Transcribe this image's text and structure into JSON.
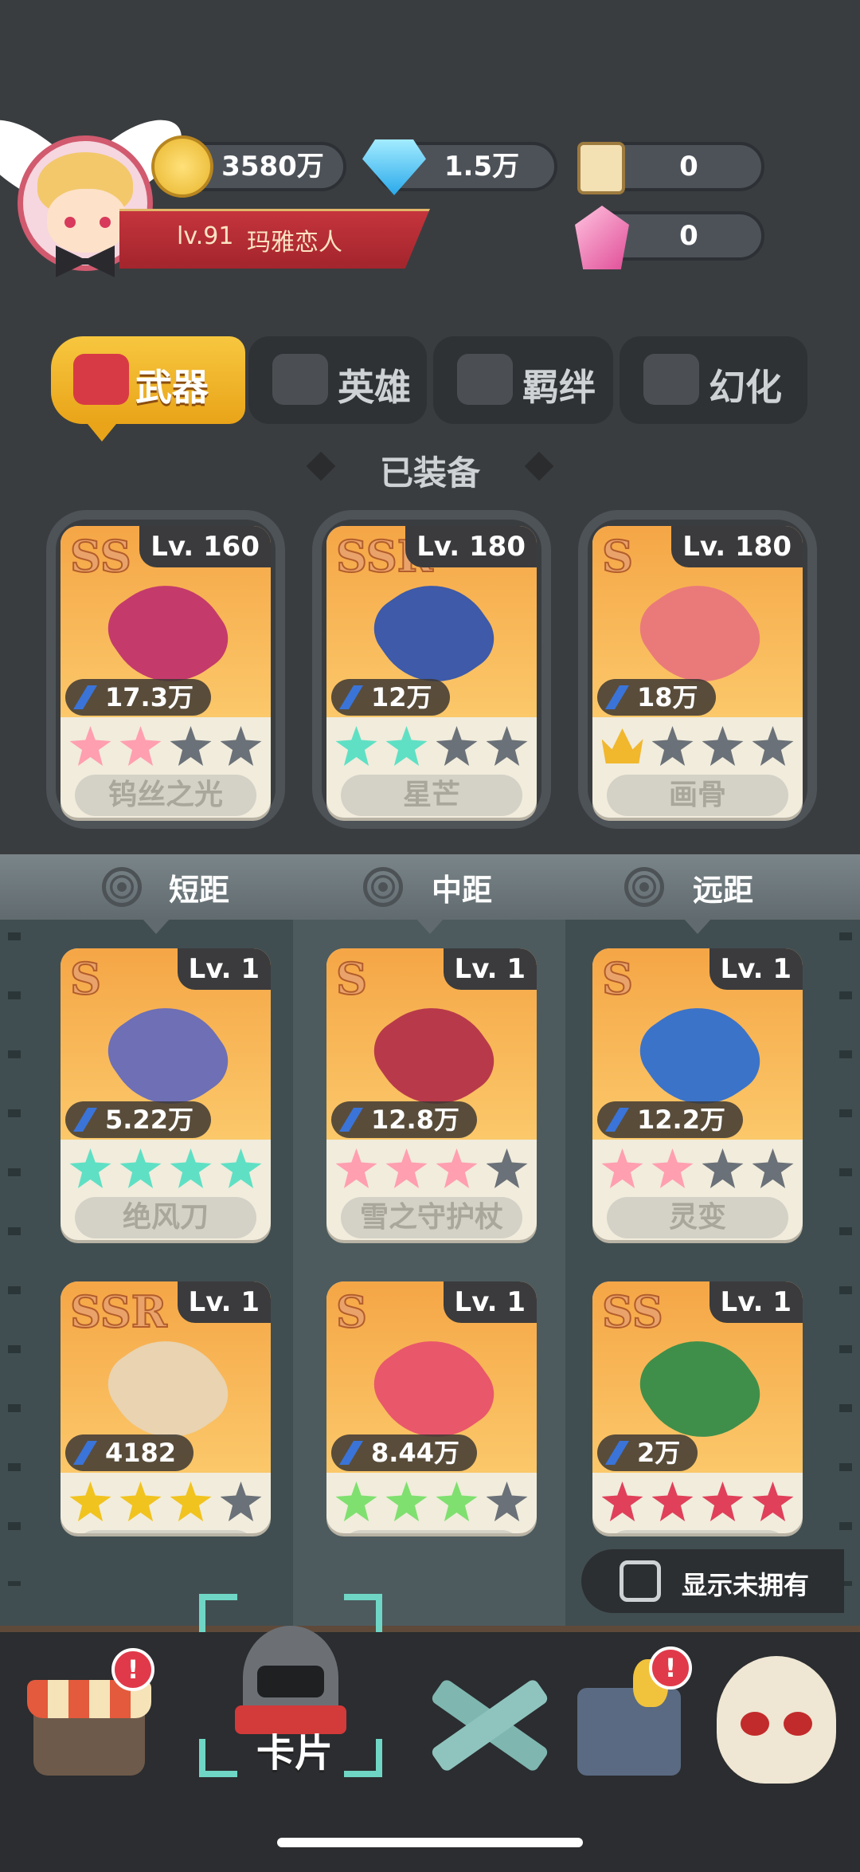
{
  "player": {
    "level": "lv.91",
    "name": "玛雅恋人"
  },
  "resources": {
    "coins": "3580万",
    "gems": "1.5万",
    "scrolls": "0",
    "crystals": "0"
  },
  "tabs": [
    {
      "label": "武器",
      "icon": "weapon-tab-icon",
      "active": true
    },
    {
      "label": "英雄",
      "icon": "hero-tab-icon",
      "active": false
    },
    {
      "label": "羁绊",
      "icon": "bond-tab-icon",
      "active": false
    },
    {
      "label": "幻化",
      "icon": "transform-tab-icon",
      "active": false
    }
  ],
  "equipped": {
    "title": "已装备",
    "cards": [
      {
        "rarity": "SS",
        "level": "Lv. 160",
        "power": "17.3万",
        "name": "钨丝之光",
        "stars": [
          1,
          1,
          0,
          0
        ],
        "star_color": "#ff9fb0",
        "crown": false,
        "weapon_color": "#c43b6b"
      },
      {
        "rarity": "SSR",
        "level": "Lv. 180",
        "power": "12万",
        "name": "星芒",
        "stars": [
          1,
          1,
          0,
          0
        ],
        "star_color": "#5fe0c4",
        "crown": false,
        "weapon_color": "#3e5aa8"
      },
      {
        "rarity": "S",
        "level": "Lv. 180",
        "power": "18万",
        "name": "画骨",
        "stars": [
          0,
          0,
          0
        ],
        "star_color": "#f1b72d",
        "crown": true,
        "weapon_color": "#ea7a7a"
      }
    ]
  },
  "ranges": [
    "短距",
    "中距",
    "远距"
  ],
  "inventory": [
    {
      "rarity": "S",
      "level": "Lv. 1",
      "power": "5.22万",
      "name": "绝风刀",
      "stars": [
        1,
        1,
        1,
        1
      ],
      "star_color": "#5fe0c4",
      "weapon_color": "#6e6fb5"
    },
    {
      "rarity": "S",
      "level": "Lv. 1",
      "power": "12.8万",
      "name": "雪之守护杖",
      "stars": [
        1,
        1,
        1,
        0
      ],
      "star_color": "#ff9fb0",
      "weapon_color": "#b83a4a"
    },
    {
      "rarity": "S",
      "level": "Lv. 1",
      "power": "12.2万",
      "name": "灵变",
      "stars": [
        1,
        1,
        0,
        0
      ],
      "star_color": "#ff9fb0",
      "weapon_color": "#3b73c9"
    },
    {
      "rarity": "SSR",
      "level": "Lv. 1",
      "power": "4182",
      "name": "",
      "stars": [
        1,
        1,
        1,
        0
      ],
      "star_color": "#f1c31f",
      "weapon_color": "#e9d3b0"
    },
    {
      "rarity": "S",
      "level": "Lv. 1",
      "power": "8.44万",
      "name": "",
      "stars": [
        1,
        1,
        1,
        0
      ],
      "star_color": "#7fe06f",
      "weapon_color": "#e9576b"
    },
    {
      "rarity": "SS",
      "level": "Lv. 1",
      "power": "2万",
      "name": "",
      "stars": [
        1,
        1,
        1,
        1
      ],
      "star_color": "#e0405a",
      "weapon_color": "#3f8f4a"
    }
  ],
  "toggle": {
    "label": "显示未拥有",
    "checked": false
  },
  "nav": {
    "shop": {
      "icon": "shop-icon",
      "badge": "!"
    },
    "card": {
      "label": "卡片",
      "icon": "knight-helmet-icon"
    },
    "battle": {
      "icon": "crossed-guns-icon"
    },
    "treasure": {
      "icon": "treasure-chest-icon",
      "badge": "!"
    },
    "boss": {
      "icon": "skull-icon"
    }
  },
  "colors": {
    "accent": "#e9a419",
    "card_bg": "#f1ecdc",
    "badge": "#e03a4a"
  }
}
